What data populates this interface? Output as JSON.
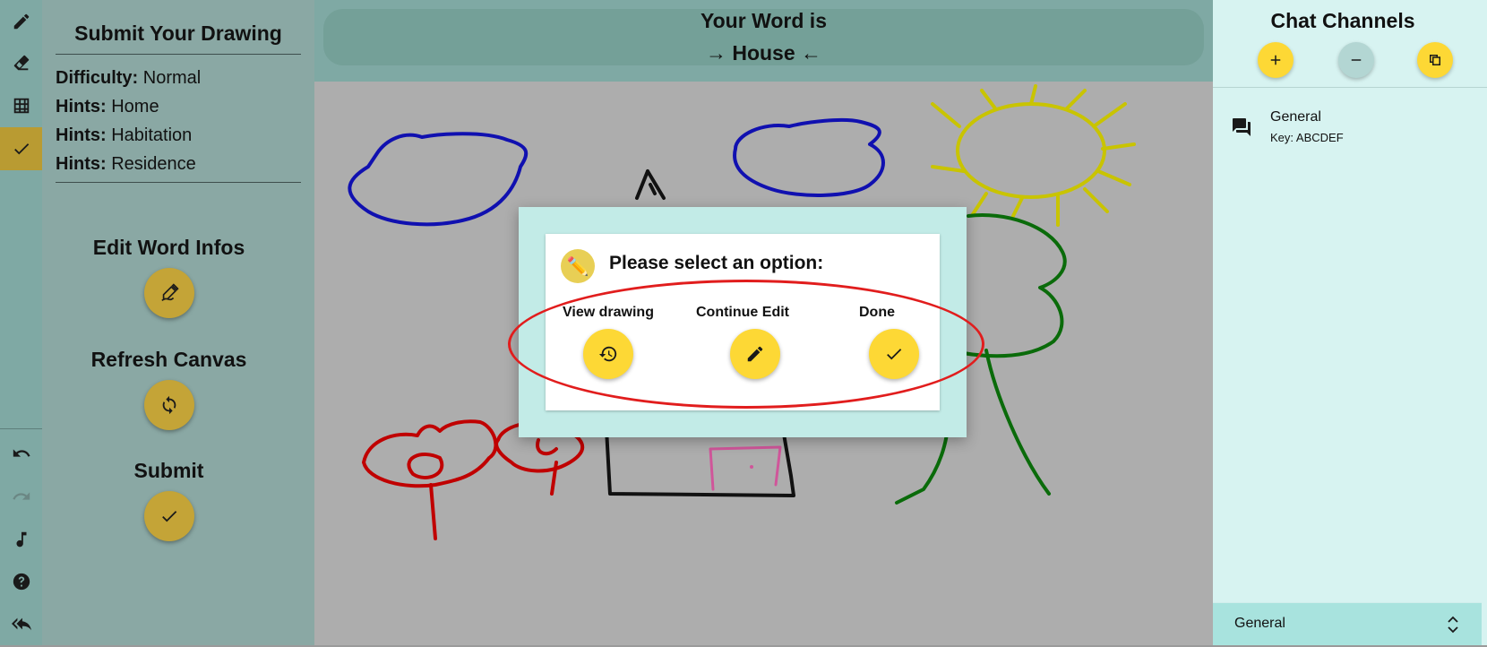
{
  "side_panel": {
    "title": "Submit Your Drawing",
    "info": [
      {
        "label": "Difficulty:",
        "value": "Normal"
      },
      {
        "label": "Hints:",
        "value": "Home"
      },
      {
        "label": "Hints:",
        "value": "Habitation"
      },
      {
        "label": "Hints:",
        "value": "Residence"
      }
    ],
    "actions": {
      "edit_word_infos": "Edit Word Infos",
      "refresh_canvas": "Refresh Canvas",
      "submit": "Submit"
    }
  },
  "header": {
    "line1": "Your Word is",
    "line2": "→ House ←"
  },
  "dialog": {
    "logo_glyph": "✏️",
    "prompt": "Please select an option:",
    "options": [
      {
        "label": "View drawing",
        "icon": "history-icon"
      },
      {
        "label": "Continue Edit",
        "icon": "pencil-icon"
      },
      {
        "label": "Done",
        "icon": "check-icon"
      }
    ]
  },
  "chat": {
    "title": "Chat Channels",
    "channels": [
      {
        "name": "General",
        "key": "Key: ABCDEF"
      }
    ],
    "selected_channel": "General"
  },
  "colors": {
    "accent_yellow": "#fdd835",
    "muted_gold": "#c4a437",
    "active_tool": "#b99b32",
    "teal_panel": "#7fa9a4",
    "chat_bg": "#d7f3f1",
    "highlight_red": "#e11d1d"
  },
  "toolbar": {
    "icons": [
      "pencil-icon",
      "eraser-icon",
      "grid-icon",
      "check-icon",
      "undo-icon",
      "redo-icon",
      "music-icon",
      "help-icon",
      "reply-all-icon"
    ],
    "active": "check-icon"
  }
}
